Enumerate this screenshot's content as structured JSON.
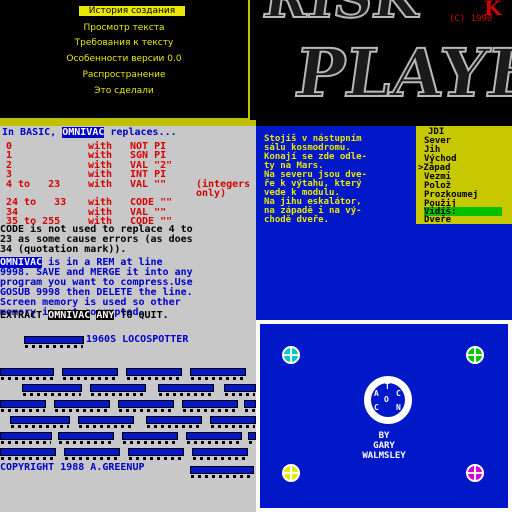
{
  "tl_menu": {
    "items": [
      "История создания",
      "Просмотр текста",
      "Требования к тексту",
      "Особенности версии 0.0",
      "Распространение",
      "Это сделали"
    ],
    "selected_index": 0
  },
  "tr_logo": {
    "word1": "RISK",
    "word2": "PLAYER",
    "copyright": "(C) 1990",
    "corner_letter": "K"
  },
  "ml_text": {
    "intro_a": "In BASIC, ",
    "omnivac": "OMNIVAC",
    "intro_b": " replaces...",
    "rows": [
      {
        "num": "0",
        "with": "with",
        "val": "NOT PI",
        "suffix": ""
      },
      {
        "num": "1",
        "with": "with",
        "val": "SGN PI",
        "suffix": ""
      },
      {
        "num": "2",
        "with": "with",
        "val": "VAL \"2\"",
        "suffix": ""
      },
      {
        "num": "3",
        "with": "with",
        "val": "INT PI",
        "suffix": ""
      },
      {
        "num": "4 to   23",
        "with": "with",
        "val": "VAL \"\"",
        "suffix": "(integers"
      },
      {
        "num": "",
        "with": "",
        "val": "",
        "suffix": "only)"
      },
      {
        "num": "24 to   33",
        "with": "with",
        "val": "CODE \"\"",
        "suffix": ""
      },
      {
        "num": "34",
        "with": "with",
        "val": "VAL \"\"",
        "suffix": ""
      },
      {
        "num": "35 to 255",
        "with": "with",
        "val": "CODE \"\"",
        "suffix": ""
      }
    ],
    "code_note": [
      "CODE is not used to replace 4 to",
      "23 as some cause errors (as does",
      "34 (quotation mark))."
    ],
    "omnivac_note_a": " is in a REM at line",
    "omnivac_note": [
      "9998. SAVE and MERGE it into any",
      "program you want to compress.Use",
      "GOSUB 9998 then DELETE the line.",
      "Screen memory is used so other",
      "memory is not corrupted."
    ],
    "extract_a": "EXTRACT ",
    "extract_b": "OMNIVAC",
    "extract_c": " ",
    "extract_d": "ANY",
    "extract_e": " TO QUIT."
  },
  "mr_adventure": {
    "lines": [
      "Stojíš v nástupním",
      "sálu kosmodromu.",
      "Konají se zde odle-",
      "ty na Mars.",
      "Na severu jsou dve-",
      "ře k výtahu, který",
      "vede k modulu.",
      "Na jihu eskalátor,",
      "na západě i na vý-",
      "chodě dveře."
    ],
    "menu": [
      "JDI",
      "Sever",
      "Jih",
      "Východ",
      ">Západ",
      "Vezmi",
      "Polož",
      "Prozkoumej",
      "Použij"
    ],
    "visible_label": "Vidíš:",
    "visible_items": [
      "Dveře"
    ]
  },
  "bl_locospotter": {
    "title": "1960S LOCOSPOTTER",
    "copyright": "COPYRIGHT 1988 A.GREENUP"
  },
  "br_title": {
    "emblem_letters": [
      "T",
      "A",
      "C",
      "O",
      "N",
      "C"
    ],
    "by": "BY",
    "author1": "GARY",
    "author2": "WALMSLEY",
    "corner_colors": [
      "#00c8c8",
      "#00c800",
      "#e8e800",
      "#d400d4"
    ]
  }
}
